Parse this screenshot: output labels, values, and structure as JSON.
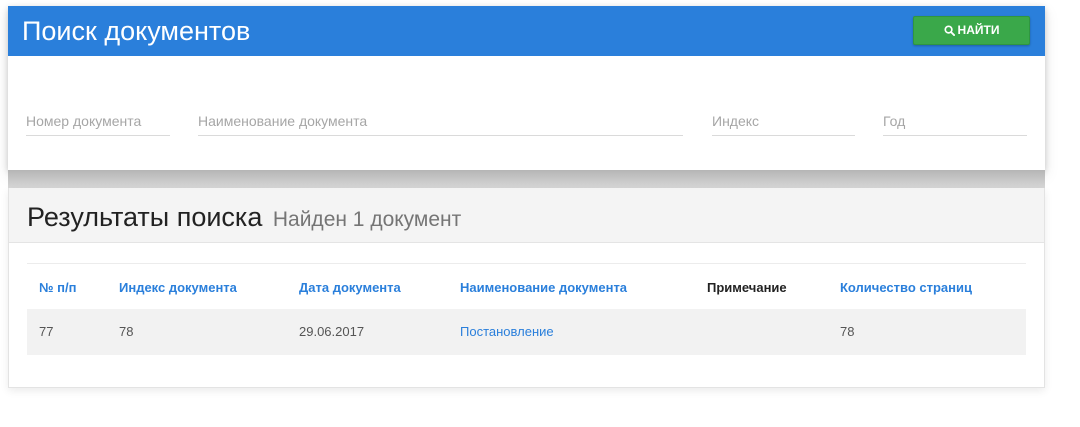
{
  "header": {
    "title": "Поиск документов",
    "find_button_label": "НАЙТИ",
    "search_icon": "search-icon"
  },
  "search_fields": {
    "doc_number_placeholder": "Номер документа",
    "doc_name_placeholder": "Наименование документа",
    "index_placeholder": "Индекс",
    "year_placeholder": "Год"
  },
  "results": {
    "title": "Результаты поиска",
    "count_text": "Найден 1 документ",
    "columns": [
      "№ п/п",
      "Индекс документа",
      "Дата документа",
      "Наименование документа",
      "Примечание",
      "Количество страниц"
    ],
    "rows": [
      {
        "num": "77",
        "index": "78",
        "date": "29.06.2017",
        "name": "Постановление",
        "note": "",
        "pages": "78"
      }
    ]
  },
  "colors": {
    "header_blue": "#2a7fdb",
    "button_green": "#3aa84a",
    "link_blue": "#2a7fdb"
  }
}
